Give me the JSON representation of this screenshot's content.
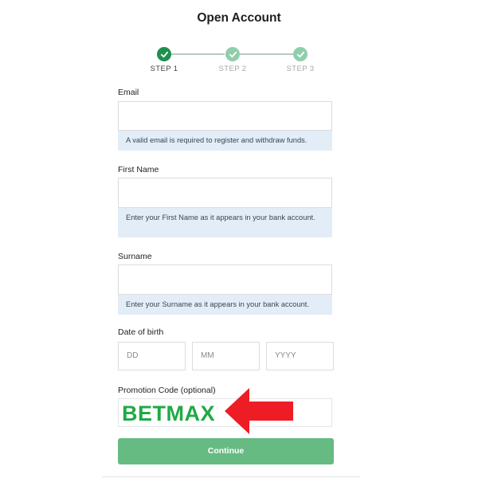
{
  "page": {
    "title": "Open Account"
  },
  "stepper": {
    "steps": [
      {
        "label": "STEP 1",
        "state": "active"
      },
      {
        "label": "STEP 2",
        "state": "inactive"
      },
      {
        "label": "STEP 3",
        "state": "inactive"
      }
    ]
  },
  "form": {
    "email": {
      "label": "Email",
      "value": "",
      "helper": "A valid email is required to register and withdraw funds."
    },
    "first_name": {
      "label": "First Name",
      "value": "",
      "helper": "Enter your First Name as it appears in your bank account."
    },
    "surname": {
      "label": "Surname",
      "value": "",
      "helper": "Enter your Surname as it appears in your bank account."
    },
    "dob": {
      "label": "Date of birth",
      "day_placeholder": "DD",
      "month_placeholder": "MM",
      "year_placeholder": "YYYY"
    },
    "promo": {
      "label": "Promotion Code (optional)",
      "value": "BETMAX"
    },
    "continue_label": "Continue"
  },
  "colors": {
    "accent": "#1e8f4f",
    "accent_light": "#90ceab",
    "button": "#66bb83",
    "helper_bg": "#e2edf7",
    "promo_text": "#1faa46",
    "arrow": "#ee1d25"
  },
  "icons": {
    "step_check": "check-icon",
    "pointer": "red-arrow-icon"
  }
}
